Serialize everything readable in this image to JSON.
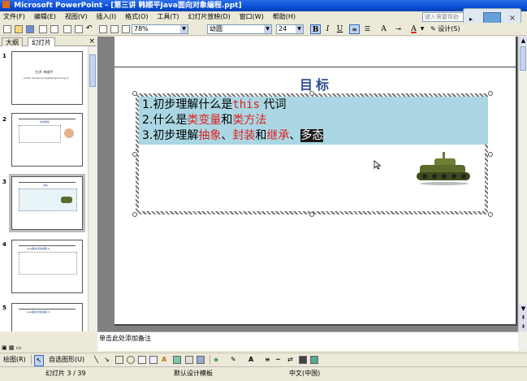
{
  "window": {
    "title": "Microsoft PowerPoint - [第三讲 韩顺平Java面向对象编程.ppt]",
    "controls": [
      "_",
      "□",
      "×"
    ]
  },
  "menu": {
    "items": [
      "文件(F)",
      "编辑(E)",
      "视图(V)",
      "插入(I)",
      "格式(O)",
      "工具(T)",
      "幻灯片放映(D)",
      "窗口(W)",
      "帮助(H)"
    ],
    "help_placeholder": "键入需要帮助"
  },
  "toolbar": {
    "zoom": "78%",
    "font": "幼圆",
    "font_size": "24",
    "bold": "B",
    "italic": "I",
    "underline": "U",
    "design_label": "设计(S)",
    "font_color": "#d22222"
  },
  "left_pane": {
    "tabs": [
      "大纲",
      "幻灯片"
    ],
    "close": "×",
    "thumbnails": [
      {
        "num": "1",
        "lines": [
          "主讲: 韩顺平",
          "email: hanshunping@tsinghua.org.cn"
        ]
      },
      {
        "num": "2",
        "lines": [
          "基本概念"
        ]
      },
      {
        "num": "3",
        "lines": [
          "目标"
        ]
      },
      {
        "num": "4",
        "lines": [
          "java面向对象编程(1)"
        ]
      },
      {
        "num": "5",
        "lines": [
          "java面向对象编程(1)"
        ]
      }
    ]
  },
  "slide": {
    "title": "目标",
    "bullets": [
      {
        "num": "1.",
        "parts": [
          {
            "t": "初步理解什么是",
            "c": "normal"
          },
          {
            "t": "this",
            "c": "red-mono"
          },
          {
            "t": " 代词",
            "c": "normal"
          }
        ]
      },
      {
        "num": "2.",
        "parts": [
          {
            "t": "什么是",
            "c": "normal"
          },
          {
            "t": "类变量",
            "c": "red"
          },
          {
            "t": "和",
            "c": "normal"
          },
          {
            "t": "类方法",
            "c": "red"
          }
        ]
      },
      {
        "num": "3.",
        "parts": [
          {
            "t": "初步理解",
            "c": "normal"
          },
          {
            "t": "抽象",
            "c": "red"
          },
          {
            "t": "、",
            "c": "normal"
          },
          {
            "t": "封装",
            "c": "red"
          },
          {
            "t": "和",
            "c": "normal"
          },
          {
            "t": "继承",
            "c": "red"
          },
          {
            "t": "、",
            "c": "normal"
          },
          {
            "t": "多态",
            "c": "selected"
          }
        ]
      }
    ]
  },
  "notes": {
    "placeholder": "单击此处添加备注"
  },
  "draw_toolbar": {
    "draw": "绘图(R)",
    "autoshapes": "自选图形(U)"
  },
  "status": {
    "slide": "幻灯片 3 / 39",
    "template": "默认设计模板",
    "language": "中文(中国)"
  }
}
